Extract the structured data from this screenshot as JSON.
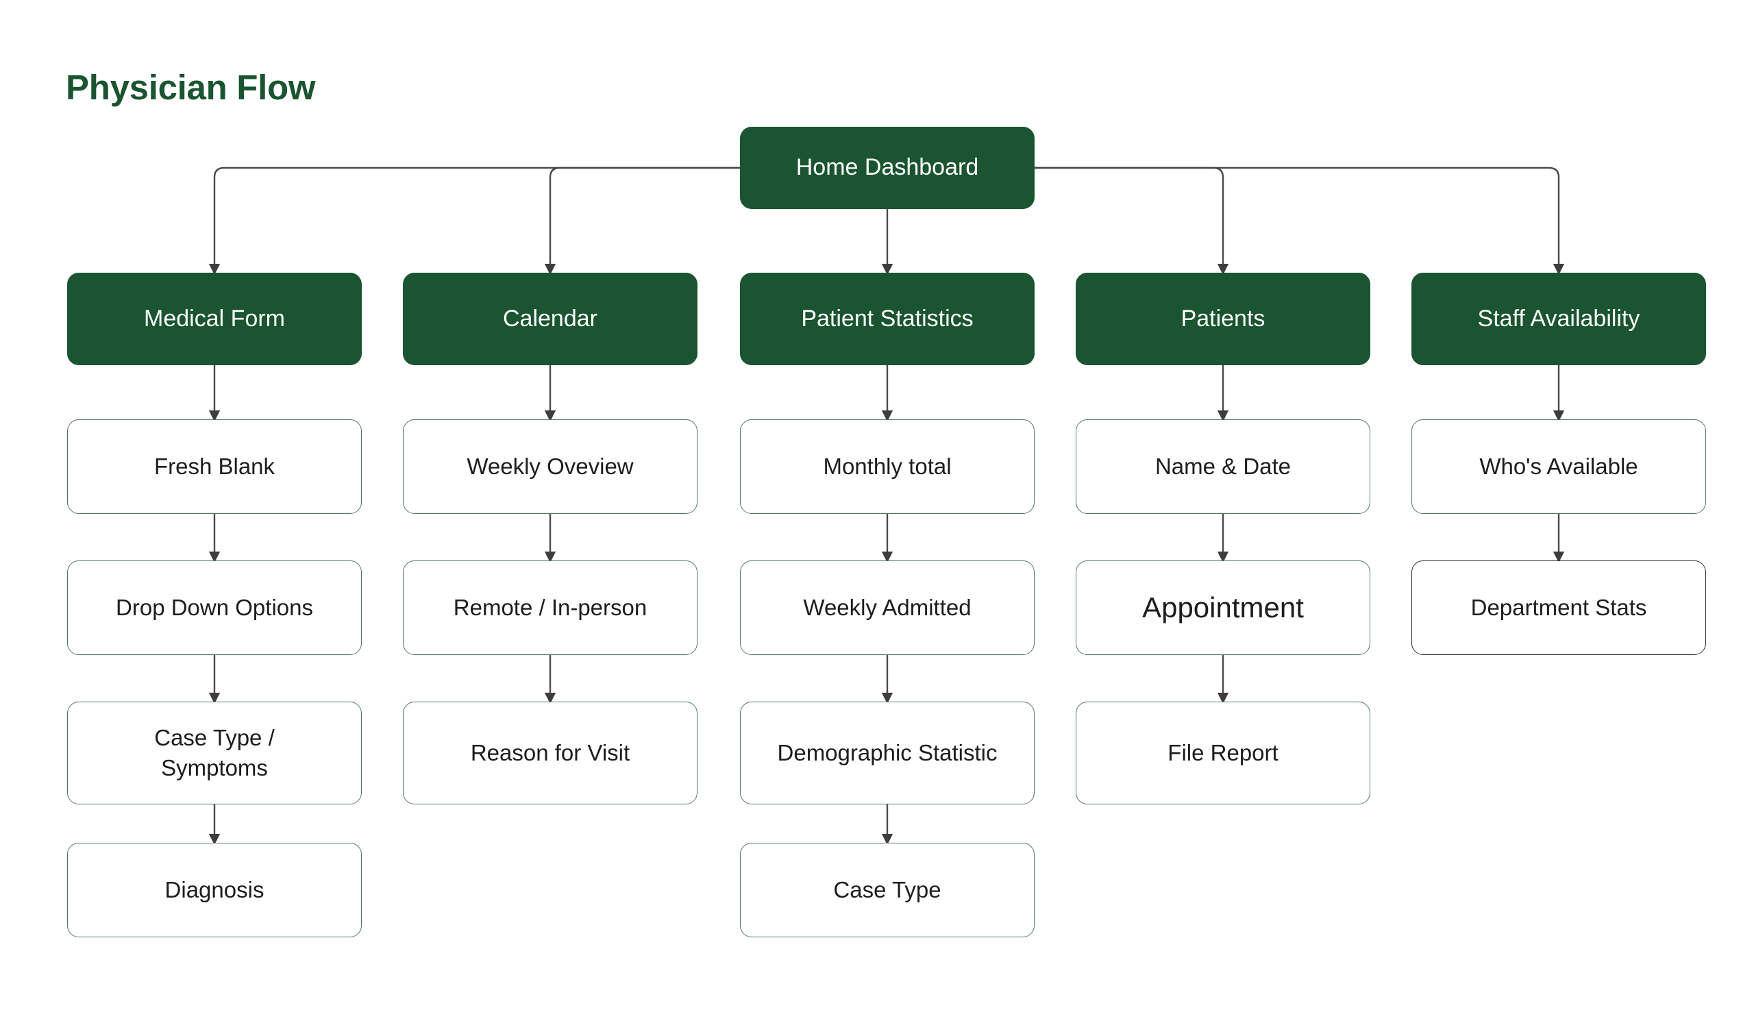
{
  "page": {
    "title": "Physician Flow",
    "background_color": "#ffffff",
    "accent_color": "#1a5430",
    "node_border_color": "#4d7a5f",
    "dark_border_color": "#2b2b2b",
    "edge_color": "#4a4a4a"
  },
  "root": {
    "label": "Home Dashboard"
  },
  "columns": [
    {
      "head": "Medical Form",
      "steps": [
        "Fresh Blank",
        "Drop Down Options",
        "Case Type /\nSymptoms",
        "Diagnosis"
      ]
    },
    {
      "head": "Calendar",
      "steps": [
        "Weekly Oveview",
        "Remote / In-person",
        "Reason for Visit"
      ]
    },
    {
      "head": "Patient Statistics",
      "steps": [
        "Monthly total",
        "Weekly Admitted",
        "Demographic Statistic",
        "Case Type"
      ]
    },
    {
      "head": "Patients",
      "steps": [
        "Name & Date",
        "Appointment",
        "File Report"
      ]
    },
    {
      "head": "Staff Availability",
      "steps": [
        "Who's Available",
        "Department Stats"
      ]
    }
  ],
  "chart_data": {
    "type": "diagram",
    "diagram_type": "flowchart-tree",
    "title": "Physician Flow",
    "orientation": "top-down",
    "root_node": "Home Dashboard",
    "nodes": [
      {
        "id": "root",
        "label": "Home Dashboard",
        "level": 0,
        "style": "filled-green"
      },
      {
        "id": "c0h",
        "label": "Medical Form",
        "level": 1,
        "style": "filled-green"
      },
      {
        "id": "c1h",
        "label": "Calendar",
        "level": 1,
        "style": "filled-green"
      },
      {
        "id": "c2h",
        "label": "Patient Statistics",
        "level": 1,
        "style": "filled-green"
      },
      {
        "id": "c3h",
        "label": "Patients",
        "level": 1,
        "style": "filled-green"
      },
      {
        "id": "c4h",
        "label": "Staff Availability",
        "level": 1,
        "style": "filled-green"
      },
      {
        "id": "c0s0",
        "label": "Fresh Blank",
        "level": 2,
        "style": "outline"
      },
      {
        "id": "c0s1",
        "label": "Drop Down Options",
        "level": 3,
        "style": "outline"
      },
      {
        "id": "c0s2",
        "label": "Case Type / Symptoms",
        "level": 4,
        "style": "outline"
      },
      {
        "id": "c0s3",
        "label": "Diagnosis",
        "level": 5,
        "style": "outline"
      },
      {
        "id": "c1s0",
        "label": "Weekly Oveview",
        "level": 2,
        "style": "outline"
      },
      {
        "id": "c1s1",
        "label": "Remote / In-person",
        "level": 3,
        "style": "outline"
      },
      {
        "id": "c1s2",
        "label": "Reason for Visit",
        "level": 4,
        "style": "outline"
      },
      {
        "id": "c2s0",
        "label": "Monthly total",
        "level": 2,
        "style": "outline"
      },
      {
        "id": "c2s1",
        "label": "Weekly Admitted",
        "level": 3,
        "style": "outline"
      },
      {
        "id": "c2s2",
        "label": "Demographic Statistic",
        "level": 4,
        "style": "outline"
      },
      {
        "id": "c2s3",
        "label": "Case Type",
        "level": 5,
        "style": "outline"
      },
      {
        "id": "c3s0",
        "label": "Name & Date",
        "level": 2,
        "style": "outline"
      },
      {
        "id": "c3s1",
        "label": "Appointment",
        "level": 3,
        "style": "outline"
      },
      {
        "id": "c3s2",
        "label": "File Report",
        "level": 4,
        "style": "outline"
      },
      {
        "id": "c4s0",
        "label": "Who's Available",
        "level": 2,
        "style": "outline"
      },
      {
        "id": "c4s1",
        "label": "Department Stats",
        "level": 3,
        "style": "outline-dark"
      }
    ],
    "edges": [
      {
        "from": "root",
        "to": "c0h"
      },
      {
        "from": "root",
        "to": "c1h"
      },
      {
        "from": "root",
        "to": "c2h"
      },
      {
        "from": "root",
        "to": "c3h"
      },
      {
        "from": "root",
        "to": "c4h"
      },
      {
        "from": "c0h",
        "to": "c0s0"
      },
      {
        "from": "c0s0",
        "to": "c0s1"
      },
      {
        "from": "c0s1",
        "to": "c0s2"
      },
      {
        "from": "c0s2",
        "to": "c0s3"
      },
      {
        "from": "c1h",
        "to": "c1s0"
      },
      {
        "from": "c1s0",
        "to": "c1s1"
      },
      {
        "from": "c1s1",
        "to": "c1s2"
      },
      {
        "from": "c2h",
        "to": "c2s0"
      },
      {
        "from": "c2s0",
        "to": "c2s1"
      },
      {
        "from": "c2s1",
        "to": "c2s2"
      },
      {
        "from": "c2s2",
        "to": "c2s3"
      },
      {
        "from": "c3h",
        "to": "c3s0"
      },
      {
        "from": "c3s0",
        "to": "c3s1"
      },
      {
        "from": "c3s1",
        "to": "c3s2"
      },
      {
        "from": "c4h",
        "to": "c4s0"
      },
      {
        "from": "c4s0",
        "to": "c4s1"
      }
    ]
  }
}
